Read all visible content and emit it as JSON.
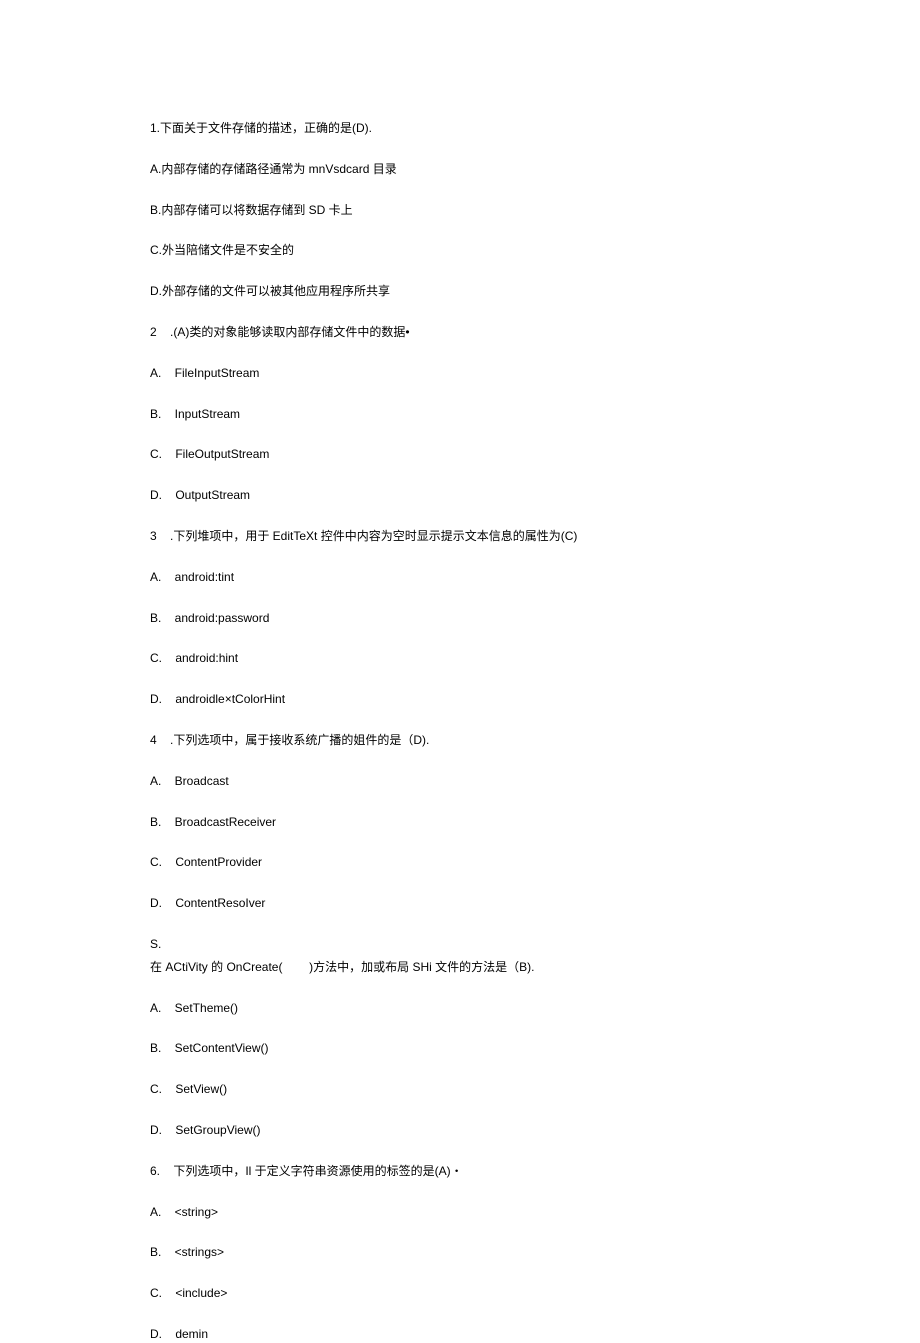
{
  "lines": [
    "1.下面关于文件存储的描述，正确的是(D).",
    "A.内部存储的存储路径通常为 mnVsdcard 目录",
    "B.内部存储可以将数据存储到 SD 卡上",
    "C.外当陪储文件是不安全的",
    "D.外部存储的文件可以被其他应用程序所共享",
    "2    .(A)类的对象能够读取内部存储文件中的数据•",
    "A.    FileInputStream",
    "B.    InputStream",
    "C.    FileOutputStream",
    "D.    OutputStream",
    "3    .下列堆项中，用于 EditTeXt 控件中内容为空时显示提示文本信息的属性为(C)",
    "A.    android:tint",
    "B.    android:password",
    "C.    android:hint",
    "D.    androidle×tColorHint",
    "4    .下列选项中，属于接收系统广播的姐件的是（D).",
    "A.    Broadcast",
    "B.    BroadcastReceiver",
    "C.    ContentProvider",
    "D.    ContentResoIver",
    "S.",
    "在 ACtiVity 的 OnCreate(        )方法中，加或布局 SHi 文件的方法是（B).",
    "A.    SetTheme()",
    "B.    SetContentView()",
    "C.    SetView()",
    "D.    SetGroupView()",
    "6.    下列选项中，Il 于定义字符串资源使用的标签的是(A)・",
    "A.    <string>",
    "B.    <strings>",
    "C.    <include>",
    "D.    demin"
  ]
}
